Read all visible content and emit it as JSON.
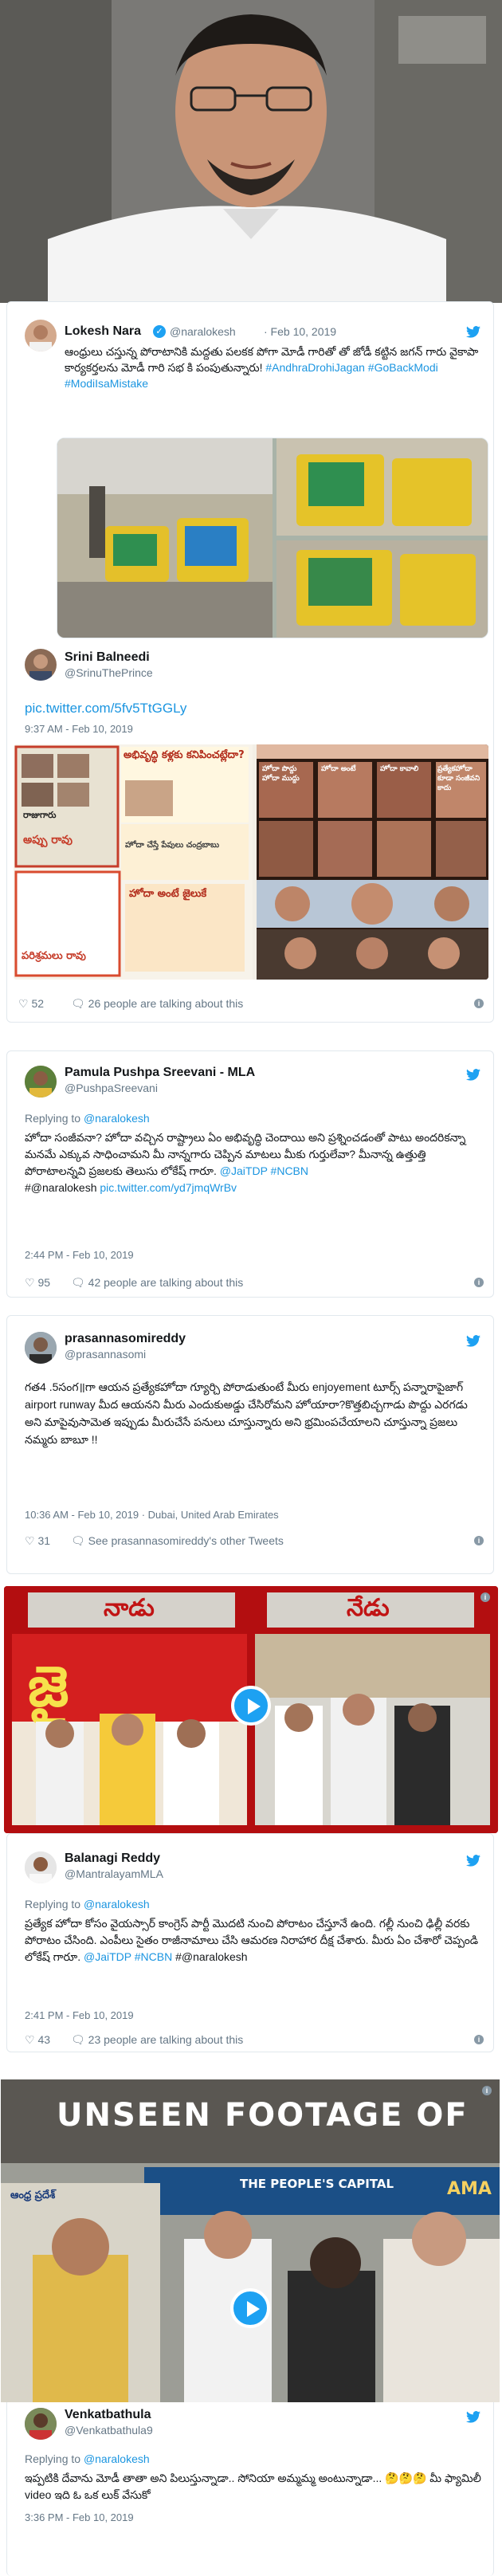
{
  "tweets": [
    {
      "name": "Lokesh Nara",
      "handle": "@naralokesh",
      "date_inline": "· Feb 10, 2019",
      "text": "ఆంధ్రులు చస్తున్న పోరాటానికి మద్దతు పలకక పోగా మోడీ గారితో తో జోడీ కట్టిన జగన్ గారు వైకాపా కార్యకర్తలను మోడీ గారి సభ కి పంపుతున్నారు!",
      "hashtags": "#AndhraDrohiJagan #GoBackModi #ModiIsaMistake",
      "quoted_name": "Srini Balneedi",
      "quoted_handle": "@SrinuThePrince",
      "pic_link": "pic.twitter.com/5fv5TtGGLy",
      "timestamp": "9:37 AM - Feb 10, 2019",
      "likes": "52",
      "talking": "26 people are talking about this"
    },
    {
      "name": "Pamula Pushpa Sreevani - MLA",
      "handle": "@PushpaSreevani",
      "reply_to_label": "Replying to",
      "reply_to": "@naralokesh",
      "text": "హోదా సంజీవనా? హోదా వచ్చిన రాష్ట్రాలు ఏం అభివృద్ధి చెందాయి అని ప్రశ్నించడంతో పాటు అందరికన్నా మనమే ఎక్కువ సాధించామని మీ నాన్నగారు చెప్పిన మాటలు మీకు గుర్తులేవా? మీనాన్న ఉత్తుత్తి పోరాటాలన్నవి ప్రజలకు తెలుసు లోకేష్ గారూ.",
      "mentions": "@JaiTDP #NCBN",
      "mention2": "#@naralokesh",
      "pic_link": "pic.twitter.com/yd7jmqWrBv",
      "timestamp": "2:44 PM - Feb 10, 2019",
      "likes": "95",
      "talking": "42 people are talking about this"
    },
    {
      "name": "prasannasomireddy",
      "handle": "@prasannasomi",
      "text": "గత4 .5సంగ॥గా ఆయన ప్రత్యేకహోదా గ్యూర్చి పోరాడుతుంటే మీరు enjoyement టూర్స్ పన్నారాపైజాగ్ airport runway మీద ఆయనని మీరు ఎందుకుఅడ్డు చేసిరోమని హోయారా?కొత్తబిచ్చగాడు పొద్దు ఎరగడు అని మాపైవుసామెత ఇప్పుడు మీరుచేసే పనులు చూస్తున్నారు అని భ్రమింపచేయాలని చూస్తున్నా ప్రజలు నమ్మరు బాబూ !!",
      "timestamp": "10:36 AM - Feb 10, 2019 · Dubai, United Arab Emirates",
      "likes": "31",
      "other_tweets": "See prasannasomireddy's other Tweets"
    },
    {
      "name": "Balanagi Reddy",
      "handle": "@MantralayamMLA",
      "reply_to_label": "Replying to",
      "reply_to": "@naralokesh",
      "text": "ప్రత్యేక హోదా కోసం వైయస్సార్ కాంగ్రెస్ పార్టీ మొదటి నుంచి పోరాటం చేస్తూనే ఉంది. గల్లీ నుంచి ఢిల్లీ వరకు పోరాటం చేసింది. ఎంపీలు సైతం రాజీనామాలు చేసి ఆమరణ నిరాహార దీక్ష చేశారు. మీరు ఏం చేశారో చెప్పండి లోకేష్ గారూ.",
      "mentions": "@JaiTDP #NCBN",
      "mention2": "#@naralokesh",
      "timestamp": "2:41 PM - Feb 10, 2019",
      "likes": "43",
      "talking": "23 people are talking about this"
    },
    {
      "name": "Venkatbathula",
      "handle": "@Venkatbathula9",
      "reply_to_label": "Replying to",
      "reply_to": "@naralokesh",
      "text": "ఇప్పటికి దేవాను మోడీ తాతా అని పిలుస్తున్నాడా.. సోనియా అమ్మమ్మ అంటున్నాడా... 🤔🤔🤔 మీ ఫ్యామిలీ video ఇది ఓ ఒక లుక్ వేసుకో",
      "timestamp": "3:36 PM - Feb 10, 2019"
    }
  ],
  "images": {
    "collage_headlines": [
      "అభివృద్ధి కళ్లకు కనిపించట్లేదా?",
      "రాజుగారు",
      "అప్పు రావు",
      "పరిశ్రమలు రావు",
      "హోదా చేస్తే పేపులు చంద్రబాబు",
      "హోదా అంటే జైలుకే"
    ],
    "memes": [
      "హోదా పొద్దు హోదా ముద్దు",
      "హోదా అంటే",
      "హోదా కావాలి",
      "ప్రత్యేకహోదా కూడా సంజీవని కాదు"
    ],
    "video1_left": "నాడు",
    "video1_right": "నేడు",
    "video2_banner": "UNSEEN FOOTAGE OF",
    "video2_sign": "THE PEOPLE'S CAPITAL",
    "video2_channel": "ఆంధ్ర ప్రదేశ్",
    "video2_brand": "AMA"
  },
  "colors": {
    "twitter_blue": "#1da1f2",
    "link_blue": "#1b95e0",
    "meta_gray": "#657786",
    "border": "#e1e8ed"
  }
}
